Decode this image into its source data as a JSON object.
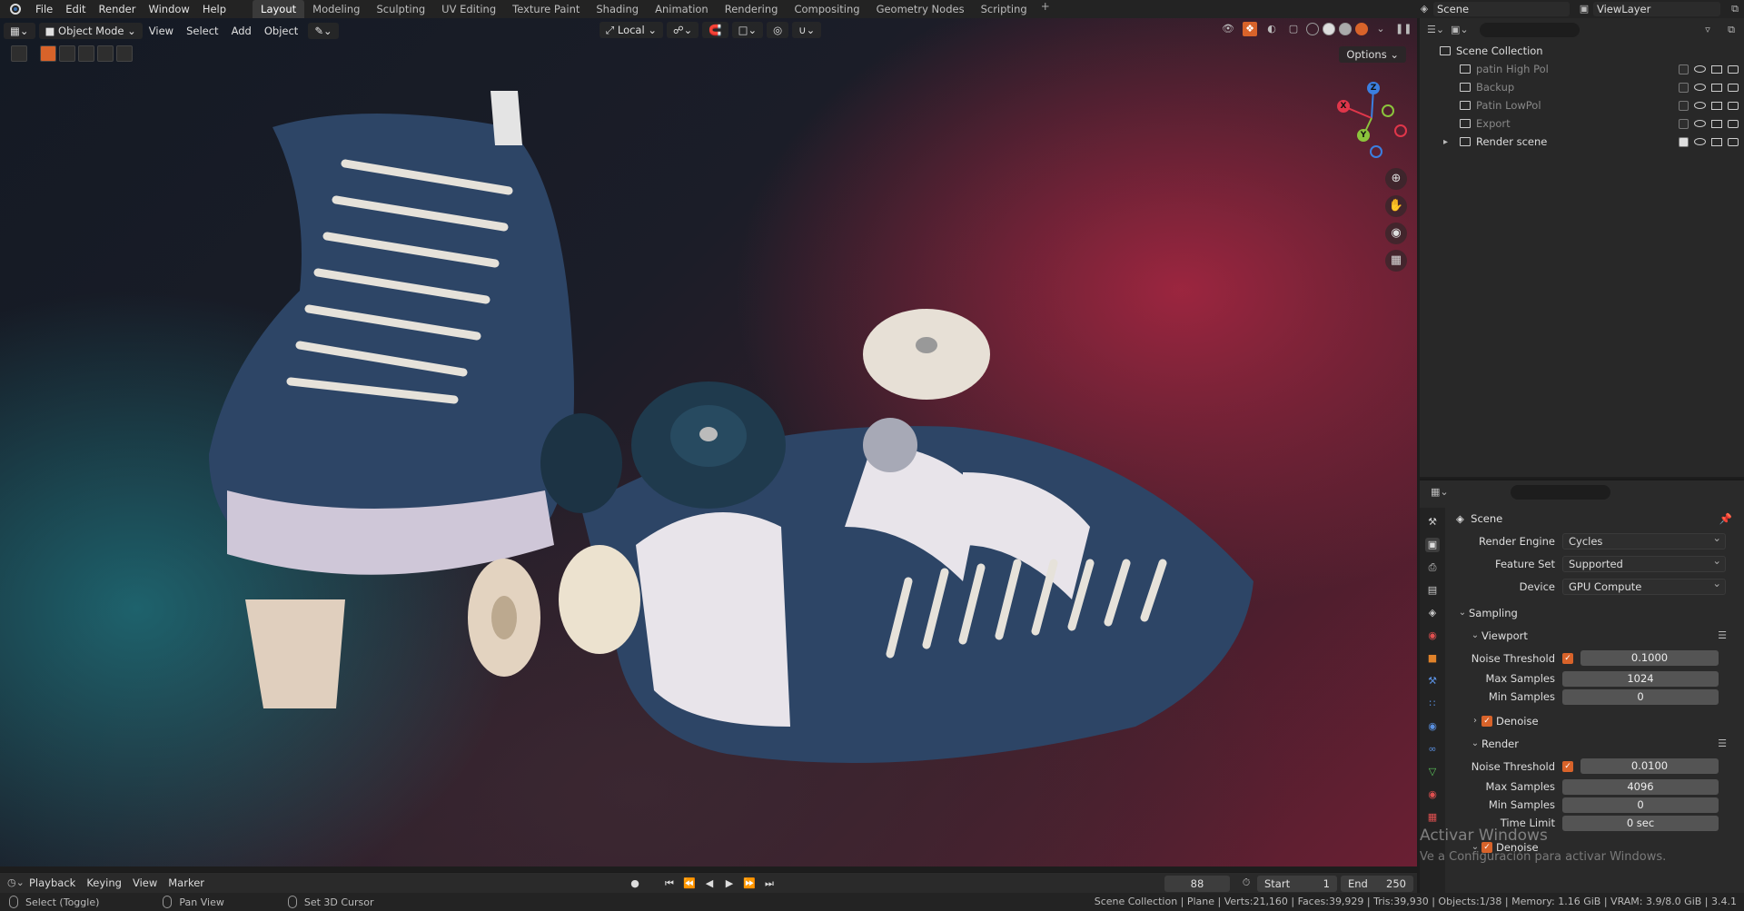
{
  "topbar": {
    "menus": [
      "File",
      "Edit",
      "Render",
      "Window",
      "Help"
    ],
    "workspaces": [
      "Layout",
      "Modeling",
      "Sculpting",
      "UV Editing",
      "Texture Paint",
      "Shading",
      "Animation",
      "Rendering",
      "Compositing",
      "Geometry Nodes",
      "Scripting"
    ],
    "active_workspace": "Layout",
    "add_tab": "+",
    "scene_name": "Scene",
    "view_layer": "ViewLayer"
  },
  "viewport": {
    "mode": "Object Mode",
    "menus": [
      "View",
      "Select",
      "Add",
      "Object"
    ],
    "orientation": "Local",
    "options_label": "Options",
    "gizmo_axes": {
      "x": "X",
      "y": "Y",
      "z": "Z"
    }
  },
  "timeline": {
    "menus": [
      "Playback",
      "Keying",
      "View",
      "Marker"
    ],
    "current_frame": "88",
    "start_label": "Start",
    "start_value": "1",
    "end_label": "End",
    "end_value": "250"
  },
  "statusbar": {
    "items": [
      "Select (Toggle)",
      "Pan View",
      "Set 3D Cursor"
    ],
    "stats": "Scene Collection | Plane | Verts:21,160 | Faces:39,929 | Tris:39,930 | Objects:1/38 | Memory: 1.16 GiB | VRAM: 3.9/8.0 GiB | 3.4.1"
  },
  "outliner": {
    "root": "Scene Collection",
    "collections": [
      {
        "name": "patin  High Pol",
        "checked": false,
        "active": false
      },
      {
        "name": "Backup",
        "checked": false,
        "active": false
      },
      {
        "name": "Patin LowPol",
        "checked": false,
        "active": false
      },
      {
        "name": "Export",
        "checked": false,
        "active": false
      },
      {
        "name": "Render scene",
        "checked": true,
        "active": true
      }
    ]
  },
  "properties": {
    "context_title": "Scene",
    "render_engine_label": "Render Engine",
    "render_engine": "Cycles",
    "feature_set_label": "Feature Set",
    "feature_set": "Supported",
    "device_label": "Device",
    "device": "GPU Compute",
    "sampling_label": "Sampling",
    "viewport_label": "Viewport",
    "vp_noise_label": "Noise Threshold",
    "vp_noise": "0.1000",
    "vp_max_label": "Max Samples",
    "vp_max": "1024",
    "vp_min_label": "Min Samples",
    "vp_min": "0",
    "denoise_label": "Denoise",
    "render_label": "Render",
    "r_noise_label": "Noise Threshold",
    "r_noise": "0.0100",
    "r_max_label": "Max Samples",
    "r_max": "4096",
    "r_min_label": "Min Samples",
    "r_min": "0",
    "r_time_label": "Time Limit",
    "r_time": "0 sec",
    "denoise2_label": "Denoise"
  },
  "overlay": {
    "activate_title": "Activar Windows",
    "activate_sub": "Ve a Configuración para activar Windows."
  },
  "colors": {
    "accent": "#d8632a",
    "x_axis": "#e0364a",
    "y_axis": "#8bc43c",
    "z_axis": "#3b7fe0"
  }
}
